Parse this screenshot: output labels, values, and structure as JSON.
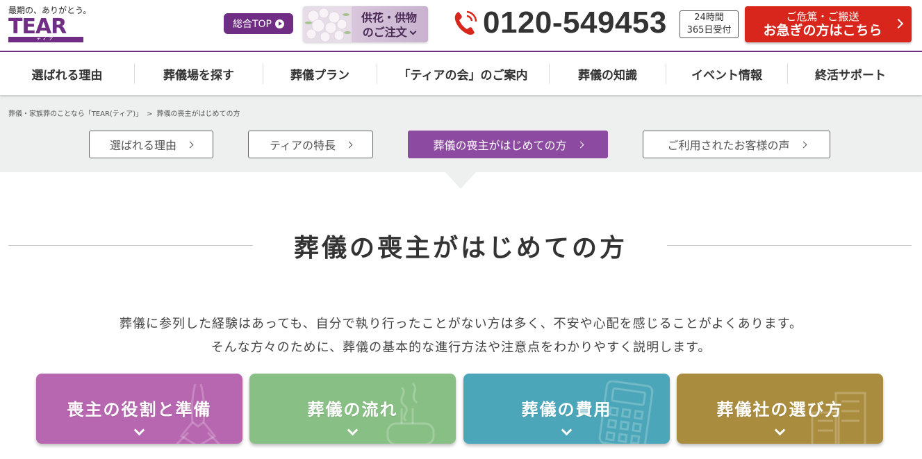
{
  "header": {
    "logo_tagline": "最期の、ありがとう。",
    "logo_word": "TEAR",
    "logo_sub": "ティア",
    "top_button": "総合TOP",
    "flower_button": [
      "供花・供物",
      "のご注文"
    ],
    "phone": "0120-549453",
    "hours": [
      "24時間",
      "365日受付"
    ],
    "urgent": [
      "ご危篤・ご搬送",
      "お急ぎの方はこちら"
    ]
  },
  "nav": [
    "選ばれる理由",
    "葬儀場を探す",
    "葬儀プラン",
    "「ティアの会」のご案内",
    "葬儀の知識",
    "イベント情報",
    "終活サポート"
  ],
  "breadcrumb": {
    "home": "葬儀・家族葬のことなら「TEAR(ティア)」",
    "separator": ">",
    "current": "葬儀の喪主がはじめての方"
  },
  "subnav": [
    {
      "label": "選ばれる理由",
      "active": false
    },
    {
      "label": "ティアの特長",
      "active": false
    },
    {
      "label": "葬儀の喪主がはじめての方",
      "active": true
    },
    {
      "label": "ご利用されたお客様の声",
      "active": false
    }
  ],
  "page_title": "葬儀の喪主がはじめての方",
  "intro": [
    "葬儀に参列した経験はあっても、自分で執り行ったことがない方は多く、不安や心配を感じることがよくあります。",
    "そんな方々のために、葬儀の基本的な進行方法や注意点をわかりやすく説明します。"
  ],
  "cards": [
    {
      "label": "喪主の役割と準備",
      "color": "#b766b0",
      "icon": "praying-hands-icon"
    },
    {
      "label": "葬儀の流れ",
      "color": "#88bf85",
      "icon": "incense-icon"
    },
    {
      "label": "葬儀の費用",
      "color": "#4aa6b8",
      "icon": "calculator-icon"
    },
    {
      "label": "葬儀社の選び方",
      "color": "#a98c3d",
      "icon": "buildings-icon"
    }
  ],
  "colors": {
    "brand": "#6f2e83",
    "accent": "#8c4aa0",
    "urgent": "#d8261c",
    "band": "#eeefef"
  }
}
